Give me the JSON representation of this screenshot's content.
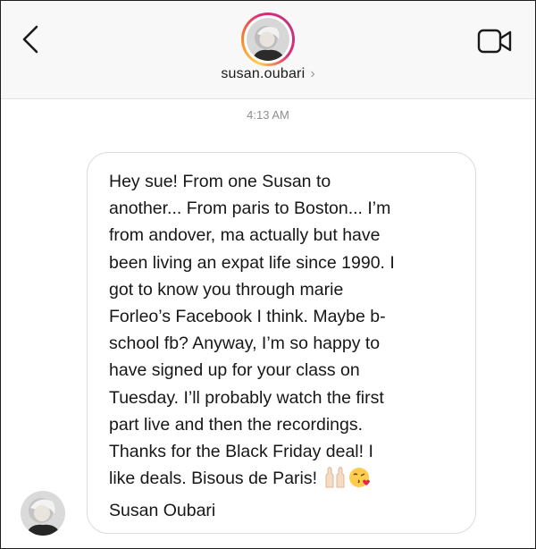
{
  "header": {
    "username": "susan.oubari",
    "username_chevron": "›"
  },
  "conversation": {
    "timestamp": "4:13 AM",
    "message": {
      "text_lines": "Hey sue! From one Susan to\nanother... From paris to Boston... I’m\nfrom andover, ma actually but have\nbeen living an expat life since 1990. I\ngot to know you through marie\nForleo’s Facebook I think. Maybe b-\nschool fb? Anyway, I’m so happy to\nhave signed up for your class on\nTuesday. I’ll probably watch the first\npart live and then the recordings.\nThanks for the Black Friday deal! I\nlike deals. Bisous de Paris!",
      "signature": "Susan Oubari",
      "emojis": [
        "raising-hands-emoji",
        "face-blowing-kiss-emoji"
      ]
    }
  },
  "colors": {
    "header_bg": "#f8f8f8",
    "timestamp": "#8e8e8e",
    "bubble_border": "#dcdcdc",
    "story_ring": [
      "#fdd04a",
      "#f58529",
      "#dd2a7b",
      "#c13584"
    ]
  }
}
